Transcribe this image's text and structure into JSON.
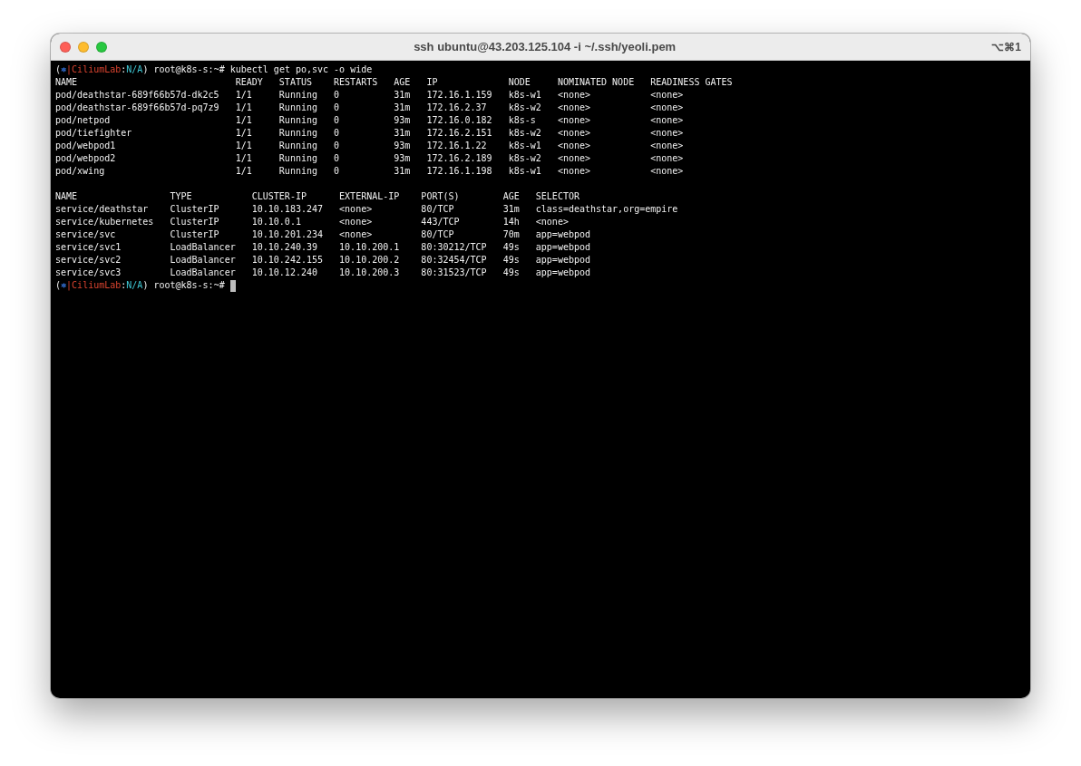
{
  "window": {
    "title": "ssh ubuntu@43.203.125.104 -i ~/.ssh/yeoli.pem",
    "shortcut": "⌥⌘1"
  },
  "terminal": {
    "lines": [
      {
        "kind": "prompt",
        "cursor": false,
        "segments": [
          {
            "text": "(",
            "kind": "plain"
          },
          {
            "text": "⎈",
            "kind": "symbol"
          },
          {
            "text": "|",
            "kind": "context"
          },
          {
            "text": "CiliumLab",
            "kind": "context"
          },
          {
            "text": ":",
            "kind": "plain"
          },
          {
            "text": "N/A",
            "kind": "namespace"
          },
          {
            "text": ") root@k8s-s:~# kubectl get po,svc -o wide",
            "kind": "plain"
          }
        ]
      },
      {
        "kind": "output",
        "text": "NAME                             READY   STATUS    RESTARTS   AGE   IP             NODE     NOMINATED NODE   READINESS GATES"
      },
      {
        "kind": "output",
        "text": "pod/deathstar-689f66b57d-dk2c5   1/1     Running   0          31m   172.16.1.159   k8s-w1   <none>           <none>"
      },
      {
        "kind": "output",
        "text": "pod/deathstar-689f66b57d-pq7z9   1/1     Running   0          31m   172.16.2.37    k8s-w2   <none>           <none>"
      },
      {
        "kind": "output",
        "text": "pod/netpod                       1/1     Running   0          93m   172.16.0.182   k8s-s    <none>           <none>"
      },
      {
        "kind": "output",
        "text": "pod/tiefighter                   1/1     Running   0          31m   172.16.2.151   k8s-w2   <none>           <none>"
      },
      {
        "kind": "output",
        "text": "pod/webpod1                      1/1     Running   0          93m   172.16.1.22    k8s-w1   <none>           <none>"
      },
      {
        "kind": "output",
        "text": "pod/webpod2                      1/1     Running   0          93m   172.16.2.189   k8s-w2   <none>           <none>"
      },
      {
        "kind": "output",
        "text": "pod/xwing                        1/1     Running   0          31m   172.16.1.198   k8s-w1   <none>           <none>"
      },
      {
        "kind": "blank"
      },
      {
        "kind": "output",
        "text": "NAME                 TYPE           CLUSTER-IP      EXTERNAL-IP    PORT(S)        AGE   SELECTOR"
      },
      {
        "kind": "output",
        "text": "service/deathstar    ClusterIP      10.10.183.247   <none>         80/TCP         31m   class=deathstar,org=empire"
      },
      {
        "kind": "output",
        "text": "service/kubernetes   ClusterIP      10.10.0.1       <none>         443/TCP        14h   <none>"
      },
      {
        "kind": "output",
        "text": "service/svc          ClusterIP      10.10.201.234   <none>         80/TCP         70m   app=webpod"
      },
      {
        "kind": "output",
        "text": "service/svc1         LoadBalancer   10.10.240.39    10.10.200.1    80:30212/TCP   49s   app=webpod"
      },
      {
        "kind": "output",
        "text": "service/svc2         LoadBalancer   10.10.242.155   10.10.200.2    80:32454/TCP   49s   app=webpod"
      },
      {
        "kind": "output",
        "text": "service/svc3         LoadBalancer   10.10.12.240    10.10.200.3    80:31523/TCP   49s   app=webpod"
      },
      {
        "kind": "prompt",
        "cursor": true,
        "segments": [
          {
            "text": "(",
            "kind": "plain"
          },
          {
            "text": "⎈",
            "kind": "symbol"
          },
          {
            "text": "|",
            "kind": "context"
          },
          {
            "text": "CiliumLab",
            "kind": "context"
          },
          {
            "text": ":",
            "kind": "plain"
          },
          {
            "text": "N/A",
            "kind": "namespace"
          },
          {
            "text": ") root@k8s-s:~#",
            "kind": "plain"
          }
        ]
      }
    ]
  }
}
